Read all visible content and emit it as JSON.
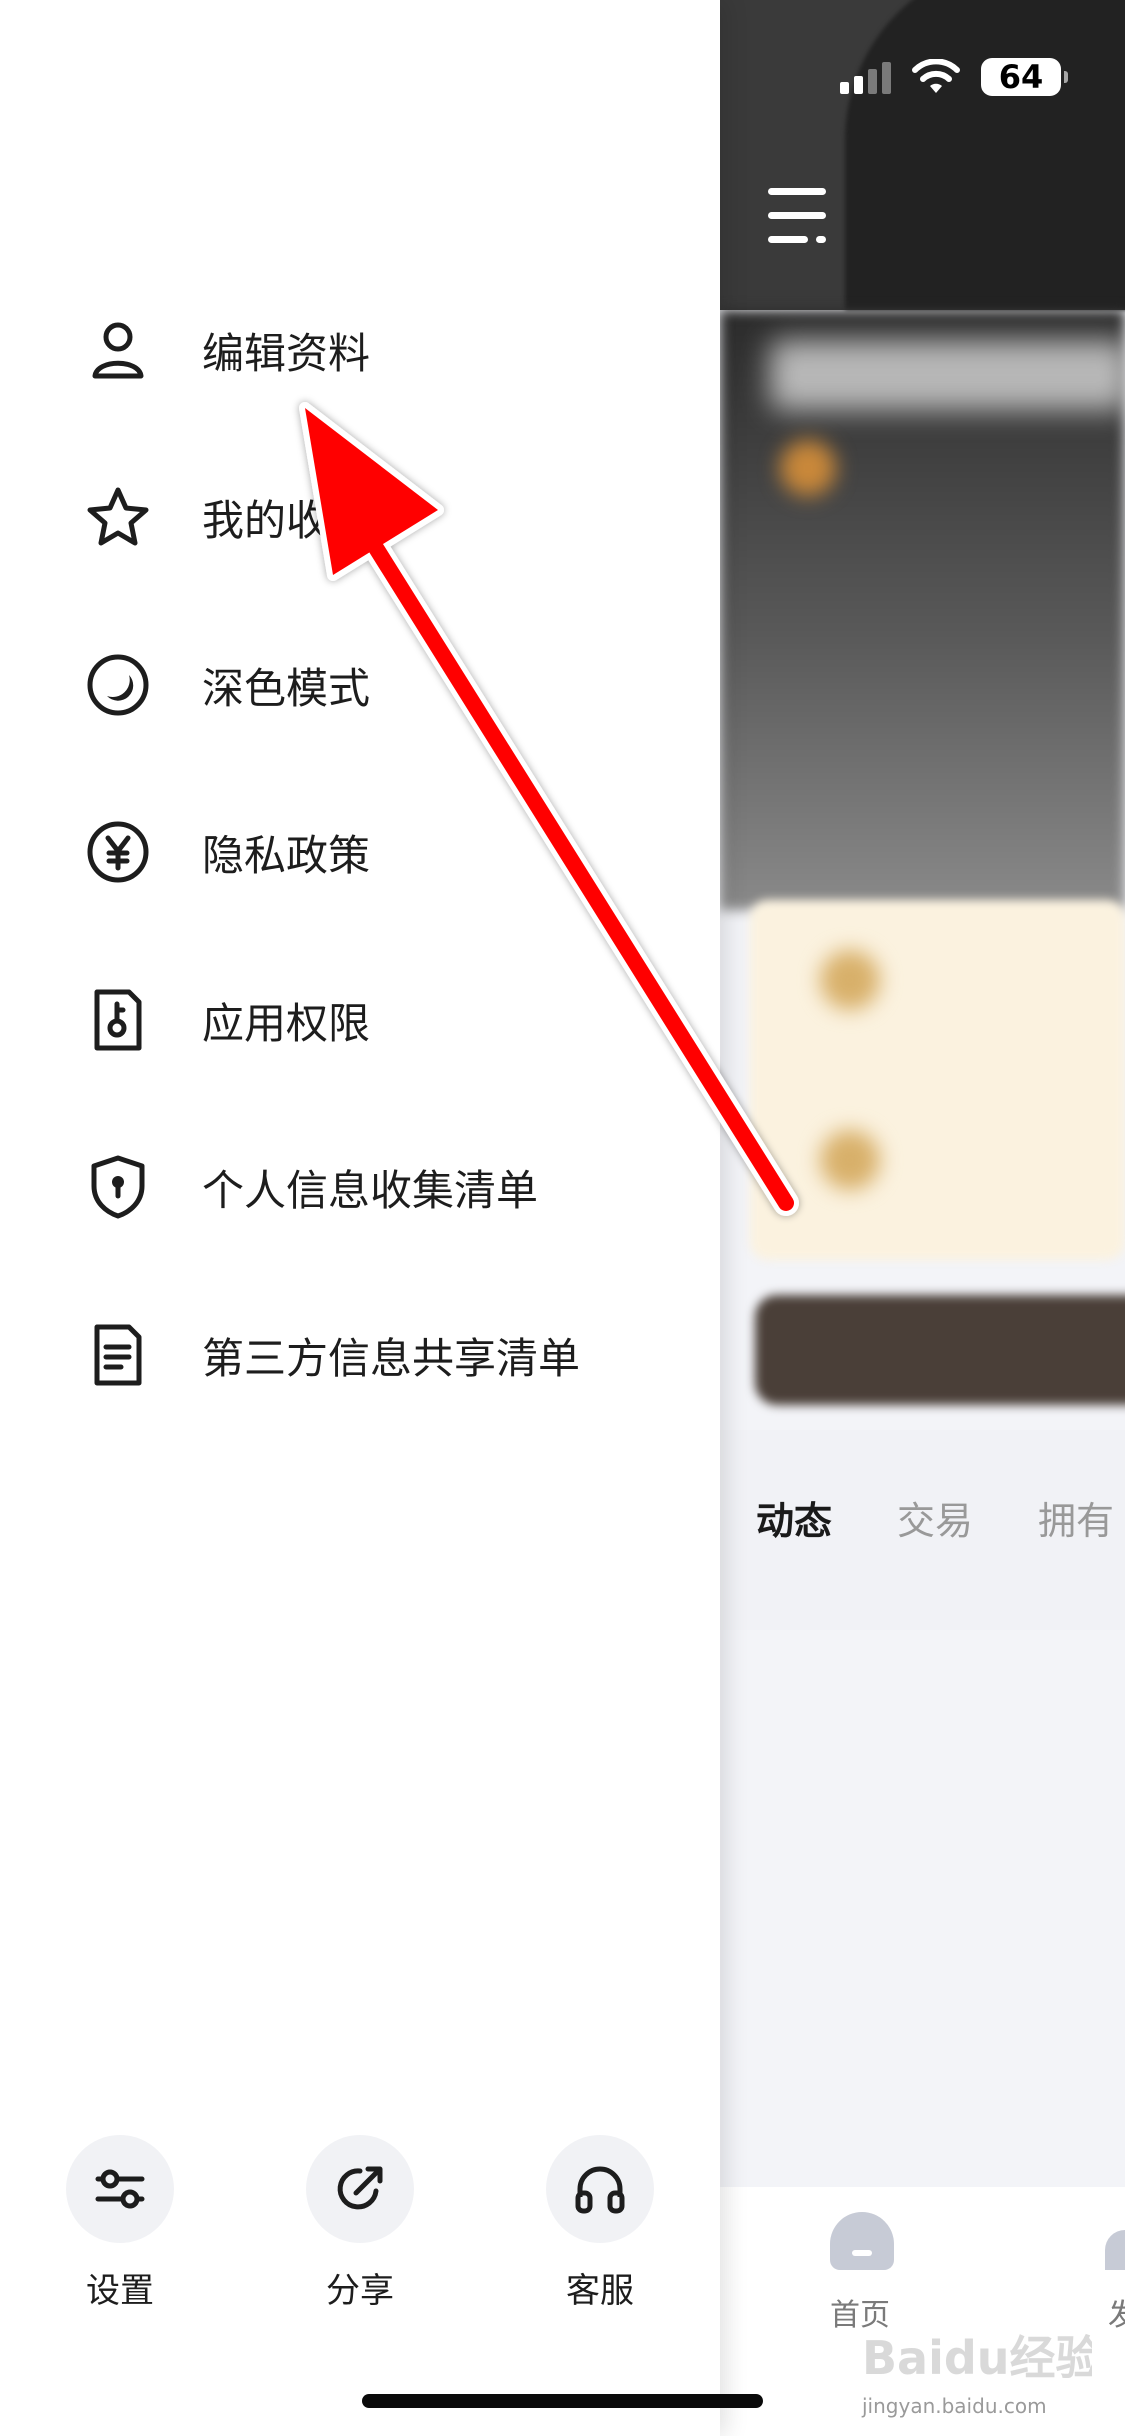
{
  "status_bar": {
    "battery": "64"
  },
  "drawer": {
    "menu": [
      {
        "label": "编辑资料",
        "icon": "user-icon"
      },
      {
        "label": "我的收",
        "icon": "star-icon"
      },
      {
        "label": "深色模式",
        "icon": "moon-icon"
      },
      {
        "label": "隐私政策",
        "icon": "yen-icon"
      },
      {
        "label": "应用权限",
        "icon": "key-doc-icon"
      },
      {
        "label": "个人信息收集清单",
        "icon": "shield-icon"
      },
      {
        "label": "第三方信息共享清单",
        "icon": "document-icon"
      }
    ],
    "actions": [
      {
        "label": "设置",
        "icon": "sliders-icon"
      },
      {
        "label": "分享",
        "icon": "share-icon"
      },
      {
        "label": "客服",
        "icon": "headphones-icon"
      }
    ]
  },
  "background_page": {
    "tabs": [
      "动态",
      "交易",
      "拥有"
    ],
    "bottom_nav": {
      "home_label": "首页",
      "second_label": "发"
    }
  },
  "annotation": {
    "arrow_color": "#ff0000"
  },
  "watermark": {
    "brand": "Baidu经验",
    "url": "jingyan.baidu.com"
  }
}
